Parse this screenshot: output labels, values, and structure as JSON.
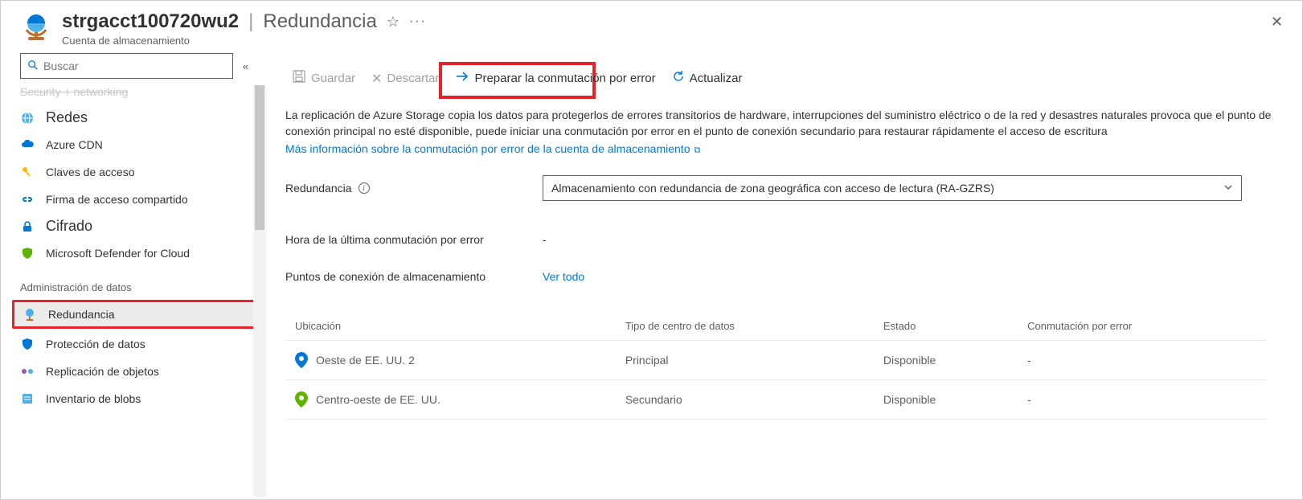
{
  "header": {
    "resource_name": "strgacct100720wu2",
    "section": "Redundancia",
    "subtitle": "Cuenta de almacenamiento"
  },
  "search": {
    "placeholder": "Buscar"
  },
  "sidebar": {
    "truncated_top": "Security + networking",
    "items": [
      {
        "kind": "heading",
        "label": "Redes",
        "icon": "globe-network"
      },
      {
        "kind": "item",
        "label": "Azure CDN",
        "icon": "cloud"
      },
      {
        "kind": "item",
        "label": "Claves de acceso",
        "icon": "key"
      },
      {
        "kind": "item",
        "label": "Firma de acceso compartido",
        "icon": "link-chain"
      },
      {
        "kind": "heading",
        "label": "Cifrado",
        "icon": "lock"
      },
      {
        "kind": "item",
        "label": "Microsoft Defender for Cloud",
        "icon": "shield"
      },
      {
        "kind": "group",
        "label": "Administración de datos"
      },
      {
        "kind": "item",
        "label": "Redundancia",
        "icon": "globe-stand",
        "selected": true
      },
      {
        "kind": "item",
        "label": "Protección de datos",
        "icon": "shield-blue"
      },
      {
        "kind": "item",
        "label": "Replicación de objetos",
        "icon": "replicate"
      },
      {
        "kind": "item",
        "label": "Inventario de blobs",
        "icon": "inventory"
      }
    ]
  },
  "toolbar": {
    "save": "Guardar",
    "discard": "Descartar",
    "prepare": "Preparar la conmutación por error",
    "refresh": "Actualizar"
  },
  "description": {
    "line": "La replicación de Azure Storage copia los datos para protegerlos de errores transitorios de hardware, interrupciones del suministro eléctrico o de la red y desastres naturales provoca que el punto de conexión principal no esté disponible, puede iniciar una conmutación por error en el punto de conexión secundario para restaurar rápidamente el acceso de escritura",
    "link": "Más información sobre la conmutación por error de la cuenta de almacenamiento"
  },
  "form": {
    "redundancy_label": "Redundancia",
    "redundancy_value": "Almacenamiento con redundancia de zona geográfica con acceso de lectura (RA-GZRS)",
    "last_failover_label": "Hora de la última conmutación por error",
    "last_failover_value": "-",
    "endpoints_label": "Puntos de conexión de almacenamiento",
    "endpoints_link": "Ver todo"
  },
  "table": {
    "headers": {
      "location": "Ubicación",
      "type": "Tipo de centro de datos",
      "status": "Estado",
      "failover": "Conmutación por error"
    },
    "rows": [
      {
        "location": "Oeste de EE. UU. 2",
        "type": "Principal",
        "status": "Disponible",
        "failover": "-",
        "pin": "#0078d4"
      },
      {
        "location": "Centro-oeste de EE. UU.",
        "type": "Secundario",
        "status": "Disponible",
        "failover": "-",
        "pin": "#5db300"
      }
    ]
  }
}
